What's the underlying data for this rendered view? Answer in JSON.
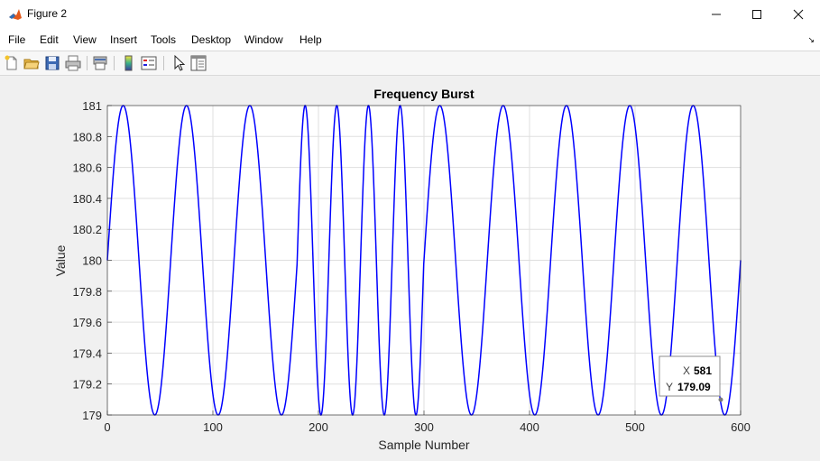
{
  "window": {
    "title": "Figure 2",
    "controls": [
      "minimize",
      "maximize",
      "close"
    ]
  },
  "menu": {
    "items": [
      "File",
      "Edit",
      "View",
      "Insert",
      "Tools",
      "Desktop",
      "Window",
      "Help"
    ]
  },
  "toolbar": {
    "icons": [
      "new-figure-icon",
      "open-file-icon",
      "save-icon",
      "print-icon",
      "print-preview-icon",
      "colorbar-icon",
      "legend-icon",
      "pointer-icon",
      "property-editor-icon"
    ]
  },
  "datatip": {
    "x_label": "X",
    "x_value": "581",
    "y_label": "Y",
    "y_value": "179.09"
  },
  "chart_data": {
    "type": "line",
    "title": "Frequency Burst",
    "xlabel": "Sample Number",
    "ylabel": "Value",
    "xlim": [
      0,
      600
    ],
    "ylim": [
      179,
      181
    ],
    "xticks": [
      "0",
      "100",
      "200",
      "300",
      "400",
      "500",
      "600"
    ],
    "yticks": [
      "179",
      "179.2",
      "179.4",
      "179.6",
      "179.8",
      "180",
      "180.2",
      "180.4",
      "180.6",
      "180.8",
      "181"
    ],
    "grid": true,
    "line_color": "#0000ff",
    "signal": {
      "baseline": 180,
      "amplitude": 1,
      "period_samples": 60,
      "burst_start": 180,
      "burst_end": 300,
      "burst_period_samples": 30
    },
    "series": [
      {
        "x": [
          0,
          15,
          45,
          75,
          105,
          135,
          165,
          180,
          187.5,
          202.5,
          217.5,
          232.5,
          247.5,
          262.5,
          277.5,
          292.5,
          300,
          315,
          345,
          375,
          405,
          435,
          465,
          495,
          525,
          555,
          585,
          600
        ],
        "values": [
          180,
          181,
          179,
          181,
          179,
          181,
          179,
          180,
          181,
          179,
          181,
          179,
          181,
          179,
          181,
          179,
          180,
          181,
          179,
          181,
          179,
          181,
          179,
          181,
          179,
          181,
          179,
          180
        ]
      }
    ]
  }
}
